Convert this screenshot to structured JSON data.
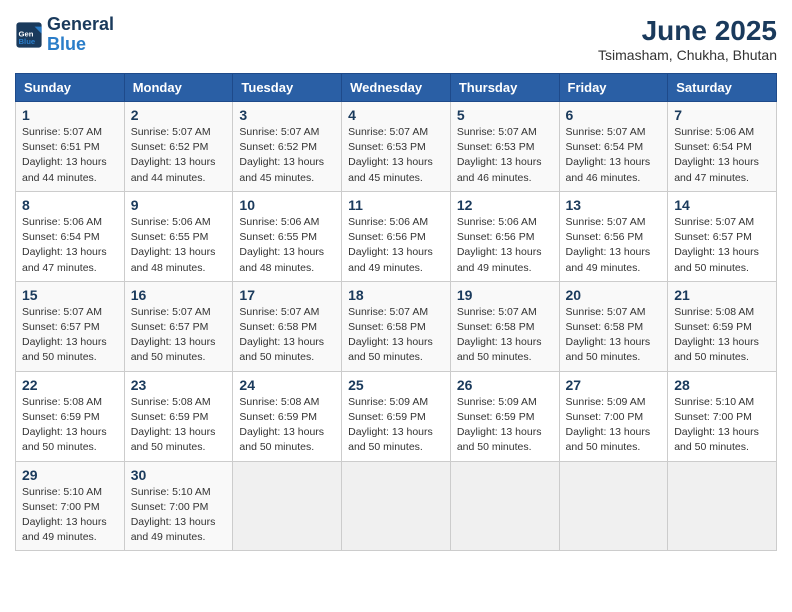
{
  "header": {
    "logo_line1": "General",
    "logo_line2": "Blue",
    "month_year": "June 2025",
    "location": "Tsimasham, Chukha, Bhutan"
  },
  "weekdays": [
    "Sunday",
    "Monday",
    "Tuesday",
    "Wednesday",
    "Thursday",
    "Friday",
    "Saturday"
  ],
  "weeks": [
    [
      {
        "day": "1",
        "info": "Sunrise: 5:07 AM\nSunset: 6:51 PM\nDaylight: 13 hours\nand 44 minutes."
      },
      {
        "day": "2",
        "info": "Sunrise: 5:07 AM\nSunset: 6:52 PM\nDaylight: 13 hours\nand 44 minutes."
      },
      {
        "day": "3",
        "info": "Sunrise: 5:07 AM\nSunset: 6:52 PM\nDaylight: 13 hours\nand 45 minutes."
      },
      {
        "day": "4",
        "info": "Sunrise: 5:07 AM\nSunset: 6:53 PM\nDaylight: 13 hours\nand 45 minutes."
      },
      {
        "day": "5",
        "info": "Sunrise: 5:07 AM\nSunset: 6:53 PM\nDaylight: 13 hours\nand 46 minutes."
      },
      {
        "day": "6",
        "info": "Sunrise: 5:07 AM\nSunset: 6:54 PM\nDaylight: 13 hours\nand 46 minutes."
      },
      {
        "day": "7",
        "info": "Sunrise: 5:06 AM\nSunset: 6:54 PM\nDaylight: 13 hours\nand 47 minutes."
      }
    ],
    [
      {
        "day": "8",
        "info": "Sunrise: 5:06 AM\nSunset: 6:54 PM\nDaylight: 13 hours\nand 47 minutes."
      },
      {
        "day": "9",
        "info": "Sunrise: 5:06 AM\nSunset: 6:55 PM\nDaylight: 13 hours\nand 48 minutes."
      },
      {
        "day": "10",
        "info": "Sunrise: 5:06 AM\nSunset: 6:55 PM\nDaylight: 13 hours\nand 48 minutes."
      },
      {
        "day": "11",
        "info": "Sunrise: 5:06 AM\nSunset: 6:56 PM\nDaylight: 13 hours\nand 49 minutes."
      },
      {
        "day": "12",
        "info": "Sunrise: 5:06 AM\nSunset: 6:56 PM\nDaylight: 13 hours\nand 49 minutes."
      },
      {
        "day": "13",
        "info": "Sunrise: 5:07 AM\nSunset: 6:56 PM\nDaylight: 13 hours\nand 49 minutes."
      },
      {
        "day": "14",
        "info": "Sunrise: 5:07 AM\nSunset: 6:57 PM\nDaylight: 13 hours\nand 50 minutes."
      }
    ],
    [
      {
        "day": "15",
        "info": "Sunrise: 5:07 AM\nSunset: 6:57 PM\nDaylight: 13 hours\nand 50 minutes."
      },
      {
        "day": "16",
        "info": "Sunrise: 5:07 AM\nSunset: 6:57 PM\nDaylight: 13 hours\nand 50 minutes."
      },
      {
        "day": "17",
        "info": "Sunrise: 5:07 AM\nSunset: 6:58 PM\nDaylight: 13 hours\nand 50 minutes."
      },
      {
        "day": "18",
        "info": "Sunrise: 5:07 AM\nSunset: 6:58 PM\nDaylight: 13 hours\nand 50 minutes."
      },
      {
        "day": "19",
        "info": "Sunrise: 5:07 AM\nSunset: 6:58 PM\nDaylight: 13 hours\nand 50 minutes."
      },
      {
        "day": "20",
        "info": "Sunrise: 5:07 AM\nSunset: 6:58 PM\nDaylight: 13 hours\nand 50 minutes."
      },
      {
        "day": "21",
        "info": "Sunrise: 5:08 AM\nSunset: 6:59 PM\nDaylight: 13 hours\nand 50 minutes."
      }
    ],
    [
      {
        "day": "22",
        "info": "Sunrise: 5:08 AM\nSunset: 6:59 PM\nDaylight: 13 hours\nand 50 minutes."
      },
      {
        "day": "23",
        "info": "Sunrise: 5:08 AM\nSunset: 6:59 PM\nDaylight: 13 hours\nand 50 minutes."
      },
      {
        "day": "24",
        "info": "Sunrise: 5:08 AM\nSunset: 6:59 PM\nDaylight: 13 hours\nand 50 minutes."
      },
      {
        "day": "25",
        "info": "Sunrise: 5:09 AM\nSunset: 6:59 PM\nDaylight: 13 hours\nand 50 minutes."
      },
      {
        "day": "26",
        "info": "Sunrise: 5:09 AM\nSunset: 6:59 PM\nDaylight: 13 hours\nand 50 minutes."
      },
      {
        "day": "27",
        "info": "Sunrise: 5:09 AM\nSunset: 7:00 PM\nDaylight: 13 hours\nand 50 minutes."
      },
      {
        "day": "28",
        "info": "Sunrise: 5:10 AM\nSunset: 7:00 PM\nDaylight: 13 hours\nand 50 minutes."
      }
    ],
    [
      {
        "day": "29",
        "info": "Sunrise: 5:10 AM\nSunset: 7:00 PM\nDaylight: 13 hours\nand 49 minutes."
      },
      {
        "day": "30",
        "info": "Sunrise: 5:10 AM\nSunset: 7:00 PM\nDaylight: 13 hours\nand 49 minutes."
      },
      {
        "day": "",
        "info": ""
      },
      {
        "day": "",
        "info": ""
      },
      {
        "day": "",
        "info": ""
      },
      {
        "day": "",
        "info": ""
      },
      {
        "day": "",
        "info": ""
      }
    ]
  ]
}
